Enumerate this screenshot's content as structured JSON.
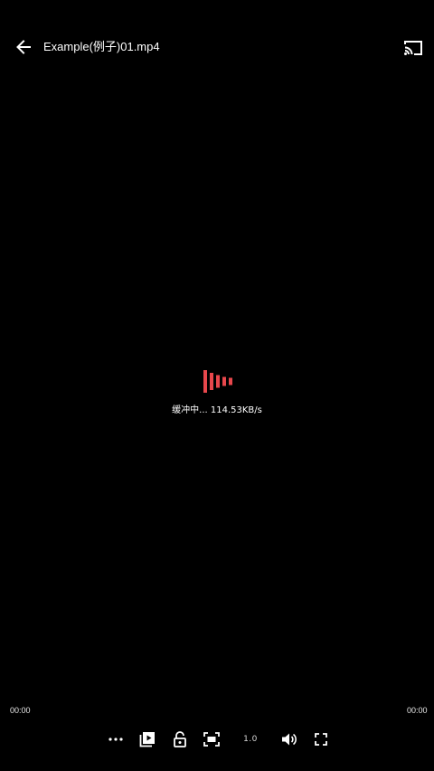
{
  "header": {
    "title": "Example(例子)01.mp4",
    "back_icon": "arrow-left-icon",
    "cast_icon": "cast-icon"
  },
  "buffering": {
    "icon": "loading-bars-icon",
    "accent_color": "#e8474c",
    "text": "缓冲中... 114.53KB/s"
  },
  "timeline": {
    "current_time": "00:00",
    "total_time": "00:00"
  },
  "controls": {
    "more_icon": "more-horizontal-icon",
    "playlist_icon": "playlist-play-icon",
    "lock_icon": "unlock-icon",
    "screenshot_icon": "screen-capture-icon",
    "speed_label": "1.0",
    "volume_icon": "volume-icon",
    "fullscreen_icon": "fullscreen-icon"
  }
}
